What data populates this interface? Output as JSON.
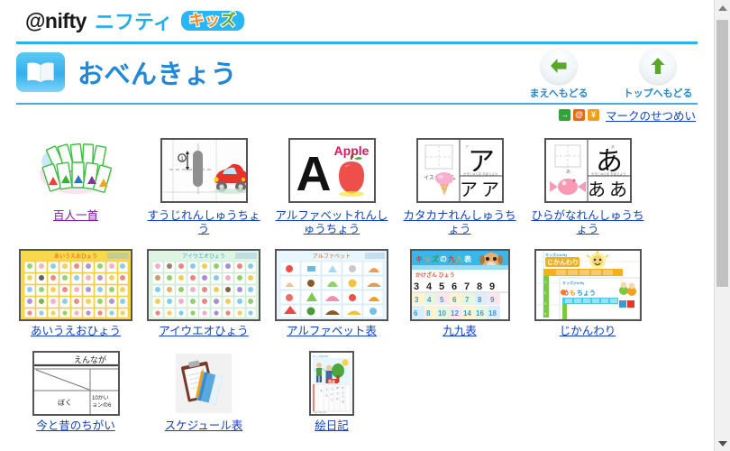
{
  "site": {
    "logo_brand": "@nifty",
    "logo_katakana": "ニフティ",
    "logo_kids_part1": "キッ",
    "logo_kids_part2": "ズ",
    "brand_blue": "#22AEEF",
    "kids_orange": "#F5881F",
    "kids_green": "#5BA829"
  },
  "header": {
    "title": "おべんきょう",
    "book_icon": "open-book-icon",
    "title_color": "#2389D6",
    "nav": [
      {
        "id": "back",
        "icon": "arrow-left-icon",
        "label": "まえへもどる",
        "arrow_color": "#5BA829"
      },
      {
        "id": "top",
        "icon": "arrow-up-icon",
        "label": "トップへもどる",
        "arrow_color": "#5BA829"
      }
    ]
  },
  "marks": {
    "badges": [
      {
        "name": "external-link-badge",
        "glyph": "→",
        "color": "#33A23B"
      },
      {
        "name": "at-mark-badge",
        "glyph": "@",
        "color": "#E8681B"
      },
      {
        "name": "yen-mark-badge",
        "glyph": "¥",
        "color": "#F2A01C"
      }
    ],
    "link_label": "マークのせつめい"
  },
  "grid": {
    "rows": [
      {
        "items": [
          {
            "name": "hyakunin-isshu",
            "label": "百人一首",
            "thumb": "karuta-cards-image",
            "bordered": false,
            "visited": true
          },
          {
            "name": "suuji-renshucho",
            "label": "すうじれんしゅうちょう",
            "thumb": "number-practice-car-image",
            "bordered": true,
            "visited": false
          },
          {
            "name": "alphabet-renshucho",
            "label": "アルファベットれんしゅうちょう",
            "thumb": "alphabet-apple-image",
            "bordered": true,
            "visited": false
          },
          {
            "name": "katakana-renshucho",
            "label": "カタカナれんしゅうちょう",
            "thumb": "katakana-a-icecream-image",
            "bordered": true,
            "visited": false
          },
          {
            "name": "hiragana-renshucho",
            "label": "ひらがなれんしゅうちょう",
            "thumb": "hiragana-a-candy-image",
            "bordered": true,
            "visited": false
          }
        ]
      },
      {
        "items": [
          {
            "name": "aiueo-hyou",
            "label": "あいうえおひょう",
            "thumb": "hiragana-chart-yellow-image",
            "bordered": true,
            "visited": false
          },
          {
            "name": "aiueo-katakana-hyou",
            "label": "アイウエオひょう",
            "thumb": "katakana-chart-green-image",
            "bordered": true,
            "visited": false
          },
          {
            "name": "alphabet-hyou",
            "label": "アルファベット表",
            "thumb": "alphabet-chart-image",
            "bordered": true,
            "visited": false
          },
          {
            "name": "kuku-hyou",
            "label": "九九表",
            "thumb": "multiplication-table-image",
            "bordered": true,
            "visited": false
          },
          {
            "name": "jikanwari",
            "label": "じかんわり",
            "thumb": "timetable-image",
            "bordered": true,
            "visited": false
          }
        ]
      },
      {
        "items": [
          {
            "name": "ima-to-mukashi",
            "label": "今と昔のちがい",
            "thumb": "comparison-worksheet-image",
            "bordered": true,
            "visited": false
          },
          {
            "name": "schedule-hyou",
            "label": "スケジュール表",
            "thumb": "clipboard-notebook-image",
            "bordered": false,
            "visited": false
          },
          {
            "name": "enikki",
            "label": "絵日記",
            "thumb": "picture-diary-image",
            "bordered": true,
            "visited": false
          }
        ]
      }
    ]
  },
  "scrollbar": {
    "up_arrow": "scroll-up-arrow",
    "down_arrow": "scroll-down-arrow",
    "thumb": "scroll-thumb"
  }
}
